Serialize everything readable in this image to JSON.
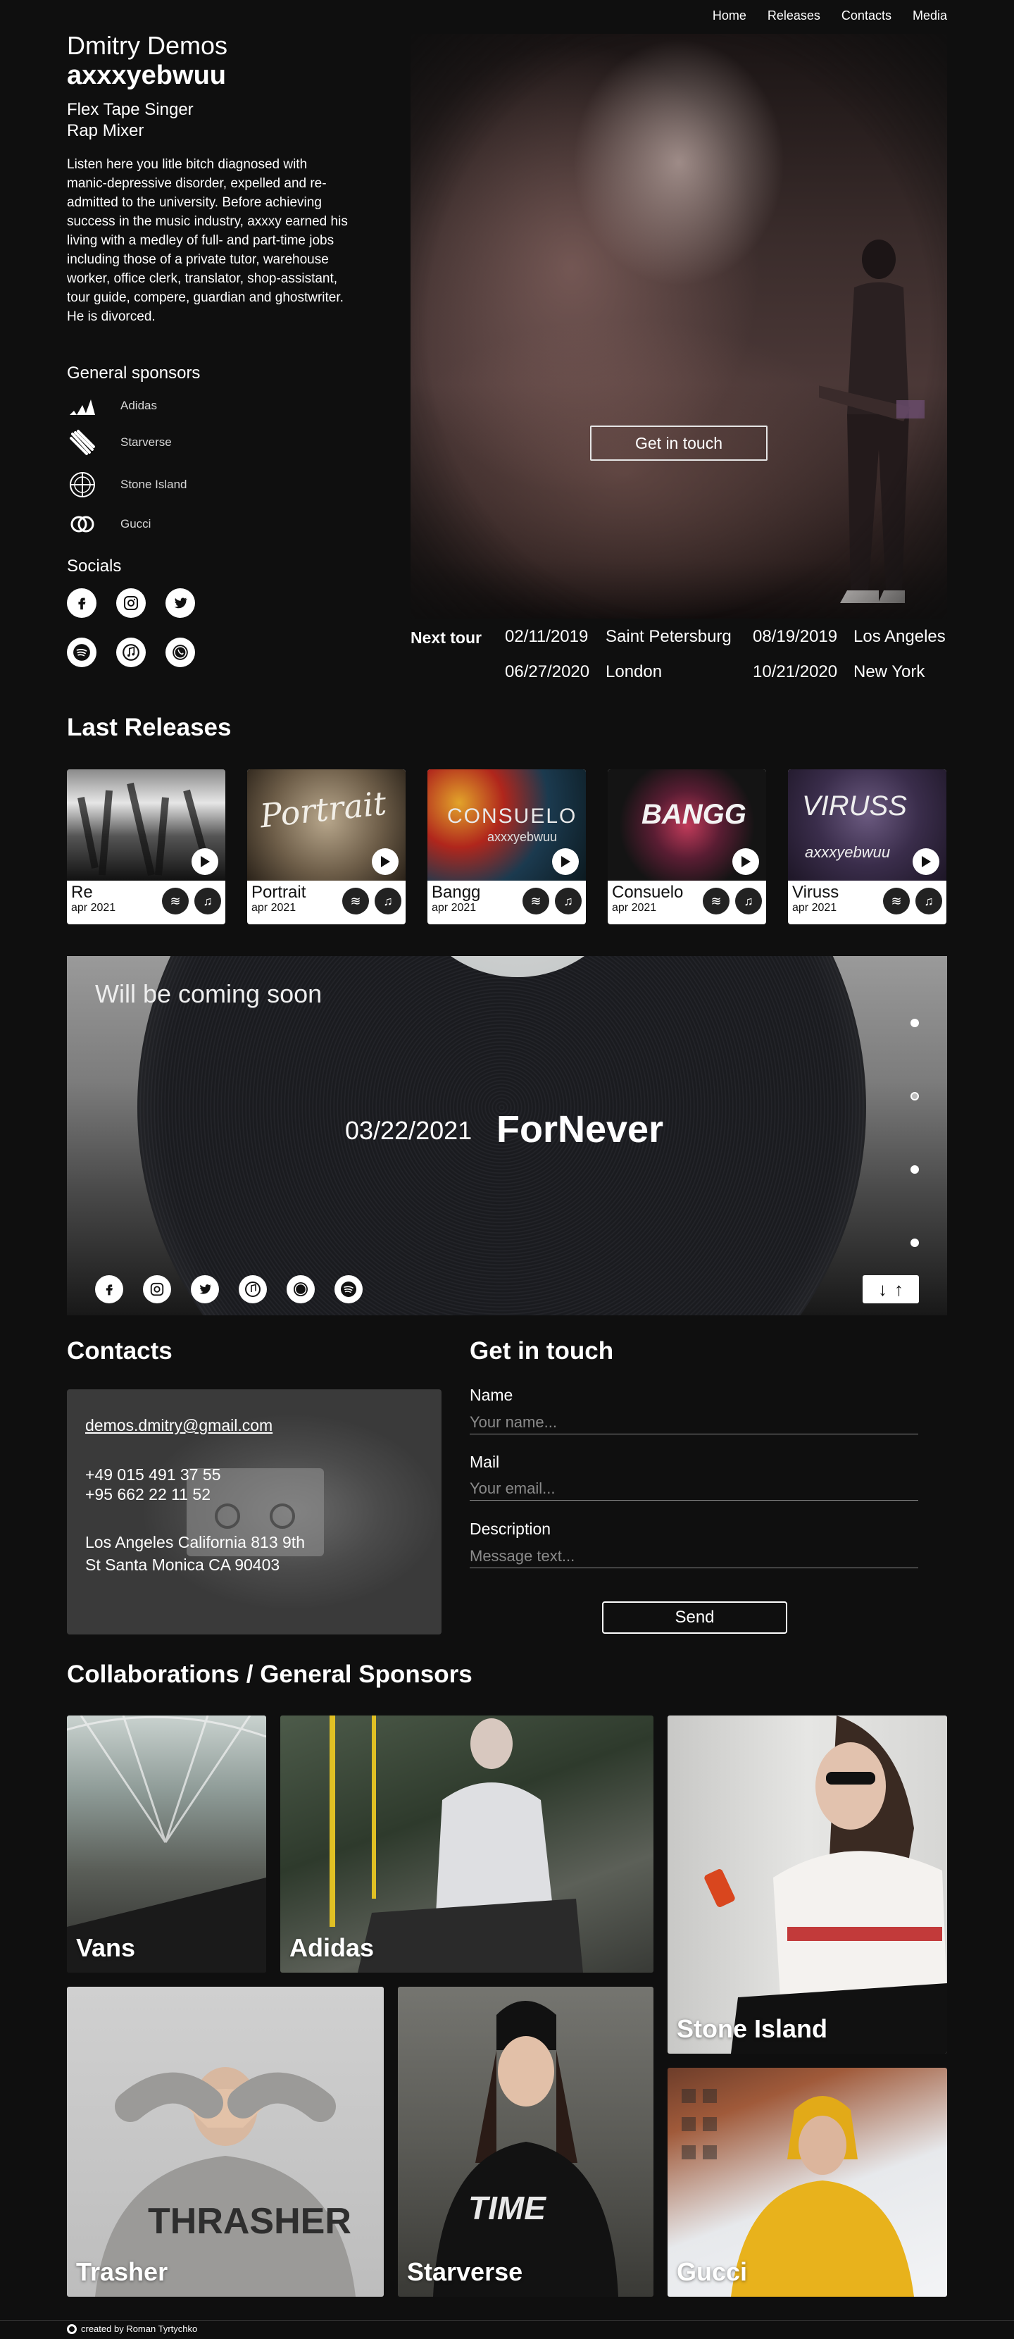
{
  "nav": [
    "Home",
    "Releases",
    "Contacts",
    "Media"
  ],
  "artist": {
    "name": "Dmitry Demos",
    "alias": "axxxyebwuu",
    "roles": [
      "Flex Tape Singer",
      "Rap Mixer"
    ],
    "bio": "Listen here you litle bitch diagnosed with manic-depressive disorder, expelled and re-admitted to the university. Before achieving success in the music industry, axxxy earned his living with a medley of full- and part-time jobs including those of a private tutor, warehouse worker, office clerk, translator, shop-assistant, tour guide, compere, guardian and ghostwriter. He is divorced."
  },
  "sponsors": {
    "title": "General sponsors",
    "items": [
      {
        "label": "Adidas",
        "icon": "adidas-icon"
      },
      {
        "label": "Starverse",
        "icon": "starverse-icon"
      },
      {
        "label": "Stone Island",
        "icon": "stone-island-icon"
      },
      {
        "label": "Gucci",
        "icon": "gucci-icon"
      }
    ]
  },
  "socials": {
    "title": "Socials",
    "row1": [
      "facebook-icon",
      "instagram-icon",
      "twitter-icon"
    ],
    "row2": [
      "spotify-icon",
      "apple-music-icon",
      "whatsapp-icon"
    ]
  },
  "hero": {
    "cta": "Get in touch"
  },
  "tour": {
    "title": "Next tour",
    "dates": [
      {
        "date": "02/11/2019",
        "city": "Saint Petersburg"
      },
      {
        "date": "08/19/2019",
        "city": "Los Angeles"
      },
      {
        "date": "06/27/2020",
        "city": "London"
      },
      {
        "date": "10/21/2020",
        "city": "New York"
      }
    ]
  },
  "releases": {
    "title": "Last Releases",
    "items": [
      {
        "title": "Re",
        "date": "apr 2021",
        "art_text": ""
      },
      {
        "title": "Portrait",
        "date": "apr 2021",
        "art_text": "Portrait"
      },
      {
        "title": "Bangg",
        "date": "apr 2021",
        "art_text": "CONSUELO"
      },
      {
        "title": "Consuelo",
        "date": "apr 2021",
        "art_text": "BANGG"
      },
      {
        "title": "Viruss",
        "date": "apr 2021",
        "art_text": "VIRUSS"
      }
    ],
    "art_subtitle": "axxxyebwuu"
  },
  "upcoming": {
    "heading": "Will be coming soon",
    "date": "03/22/2021",
    "title": "ForNever",
    "socials": [
      "facebook-icon",
      "instagram-icon",
      "twitter-icon",
      "apple-music-icon",
      "whatsapp-icon",
      "spotify-icon"
    ],
    "slides": 4,
    "active_slide": 2
  },
  "contacts": {
    "title": "Contacts",
    "email": "demos.dmitry@gmail.com",
    "phones": [
      "+49 015 491 37 55",
      "+95 662 22 11 52"
    ],
    "address": [
      "Los Angeles California 813 9th",
      "St Santa Monica CA 90403"
    ]
  },
  "form": {
    "title": "Get in touch",
    "name_label": "Name",
    "name_placeholder": "Your name...",
    "mail_label": "Mail",
    "mail_placeholder": "Your email...",
    "desc_label": "Description",
    "desc_placeholder": "Message text...",
    "send": "Send"
  },
  "collabs": {
    "title": "Collaborations / General Sponsors",
    "tiles": [
      "Vans",
      "Adidas",
      "Stone Island",
      "Trasher",
      "Starverse",
      "Gucci"
    ]
  },
  "footer": "created by Roman Tyrtychko"
}
